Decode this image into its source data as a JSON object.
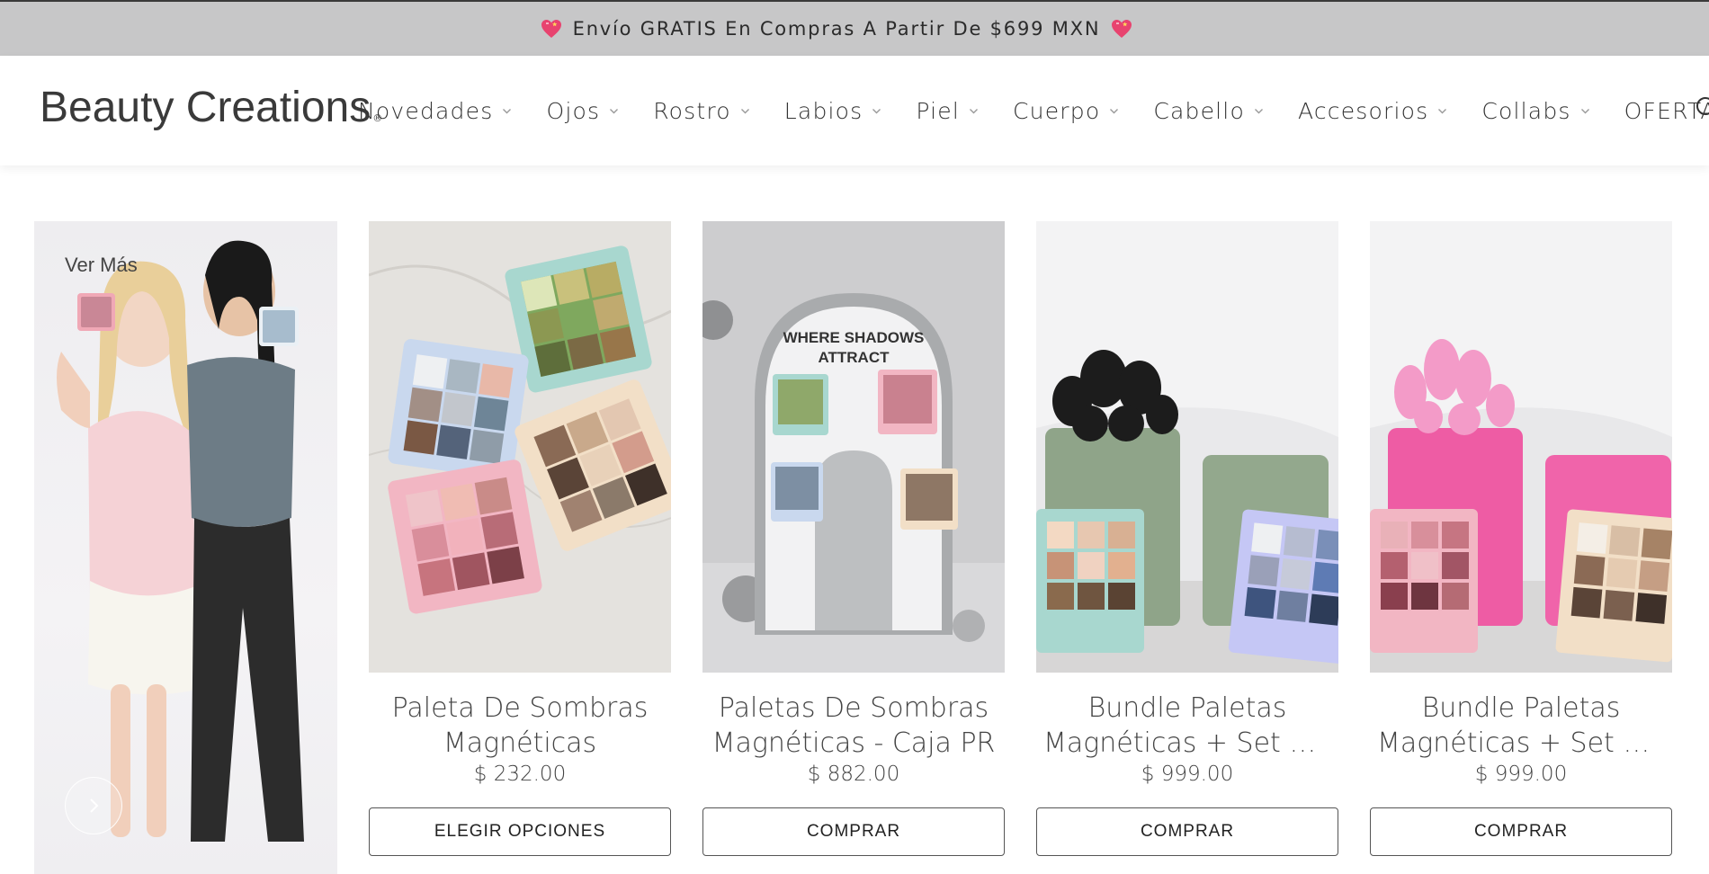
{
  "announcement": {
    "text": "Envío GRATIS En Compras A Partir De $699 MXN"
  },
  "header": {
    "logo_text": "Beauty Creations",
    "logo_mark": "®",
    "nav": [
      {
        "label": "Novedades"
      },
      {
        "label": "Ojos"
      },
      {
        "label": "Rostro"
      },
      {
        "label": "Labios"
      },
      {
        "label": "Piel"
      },
      {
        "label": "Cuerpo"
      },
      {
        "label": "Cabello"
      },
      {
        "label": "Accesorios"
      },
      {
        "label": "Collabs"
      },
      {
        "label": "OFERTAS"
      }
    ]
  },
  "promo": {
    "link_label": "Ver Más"
  },
  "products": [
    {
      "title_1": "Paleta De Sombras",
      "title_2": "Magnéticas",
      "price": "$ 232.00",
      "button": "ELEGIR OPCIONES"
    },
    {
      "title_1": "Paletas De Sombras",
      "title_2": "Magnéticas - Caja PR",
      "price": "$ 882.00",
      "button": "COMPRAR"
    },
    {
      "title_1": "Bundle Paletas",
      "title_2": "Magnéticas + Set de...",
      "price": "$ 999.00",
      "button": "COMPRAR"
    },
    {
      "title_1": "Bundle Paletas",
      "title_2": "Magnéticas + Set de...",
      "price": "$ 999.00",
      "button": "COMPRAR"
    }
  ],
  "colors": {
    "announce_bg": "#c7c7c8",
    "text": "#333333",
    "heart": "#e8436f"
  },
  "icons": [
    "heart-icon",
    "chevron-down-icon",
    "search-icon",
    "chevron-right-icon"
  ]
}
